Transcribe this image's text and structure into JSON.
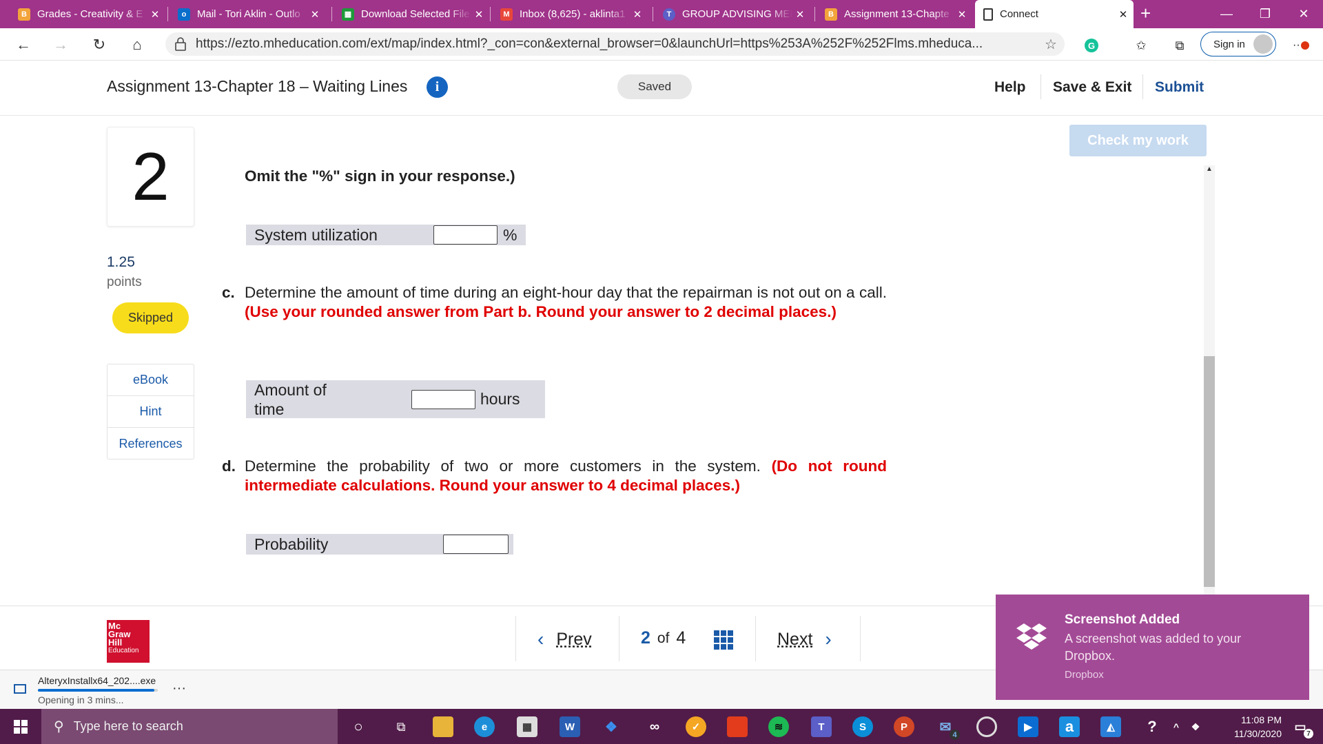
{
  "browser": {
    "tabs": [
      {
        "title": "Grades - Creativity & E",
        "favicon": "B",
        "favicon_color": "#f3a33b"
      },
      {
        "title": "Mail - Tori Aklin - Outlo",
        "favicon": "o",
        "favicon_color": "#0a6ecb"
      },
      {
        "title": "Download Selected File",
        "favicon": "▦",
        "favicon_color": "#1e9a3a"
      },
      {
        "title": "Inbox (8,625) - aklinta1",
        "favicon": "M",
        "favicon_color": "#e8473b"
      },
      {
        "title": "GROUP ADVISING MEE",
        "favicon": "T",
        "favicon_color": "#5b5fc7"
      },
      {
        "title": "Assignment 13-Chapte",
        "favicon": "B",
        "favicon_color": "#f3a33b"
      },
      {
        "title": "Connect",
        "favicon": "□",
        "favicon_color": "#ffffff"
      }
    ],
    "url": "https://ezto.mheducation.com/ext/map/index.html?_con=con&external_browser=0&launchUrl=https%253A%252F%252Flms.mheduca...",
    "sign_in": "Sign in"
  },
  "header": {
    "title": "Assignment 13-Chapter 18 – Waiting Lines",
    "saved": "Saved",
    "help": "Help",
    "save_exit": "Save & Exit",
    "submit": "Submit"
  },
  "question": {
    "number": "2",
    "points": "1.25",
    "points_label": "points",
    "status": "Skipped",
    "resources": [
      "eBook",
      "Hint",
      "References"
    ],
    "check_my_work": "Check my work"
  },
  "content": {
    "omit_note": "Omit the \"%\" sign in your response.)",
    "util_label": "System utilization",
    "util_unit": "%",
    "c_label": "c.",
    "c_text": "Determine the amount of time during an eight-hour day that the repairman is not out on a call.",
    "c_note": "(Use your rounded answer from Part b. Round your answer to 2 decimal places.)",
    "time_label": "Amount of time",
    "time_unit": "hours",
    "d_label": "d.",
    "d_text": "Determine the probability of two or more customers in the system.",
    "d_note": "(Do not round intermediate calculations. Round your answer to 4 decimal places.)",
    "prob_label": "Probability",
    "util_value": "",
    "time_value": "",
    "prob_value": ""
  },
  "footer": {
    "logo_lines": [
      "Mc",
      "Graw",
      "Hill",
      "Education"
    ],
    "prev": "Prev",
    "page_current": "2",
    "page_of": "of",
    "page_total": "4",
    "next": "Next"
  },
  "download": {
    "file": "AlteryxInstallx64_202....exe",
    "status": "Opening in 3 mins...",
    "progress": 0.97
  },
  "toast": {
    "title": "Screenshot Added",
    "body": "A screenshot was added to your Dropbox.",
    "source": "Dropbox"
  },
  "taskbar": {
    "search_placeholder": "Type here to search",
    "time": "11:08 PM",
    "date": "11/30/2020",
    "mail_badge": "4",
    "notif_badge": "7"
  },
  "colors": {
    "browser_accent": "#a0338a",
    "required_note": "#e00000",
    "skipped_badge": "#f7dc1b",
    "link_blue": "#1a5aa8"
  }
}
